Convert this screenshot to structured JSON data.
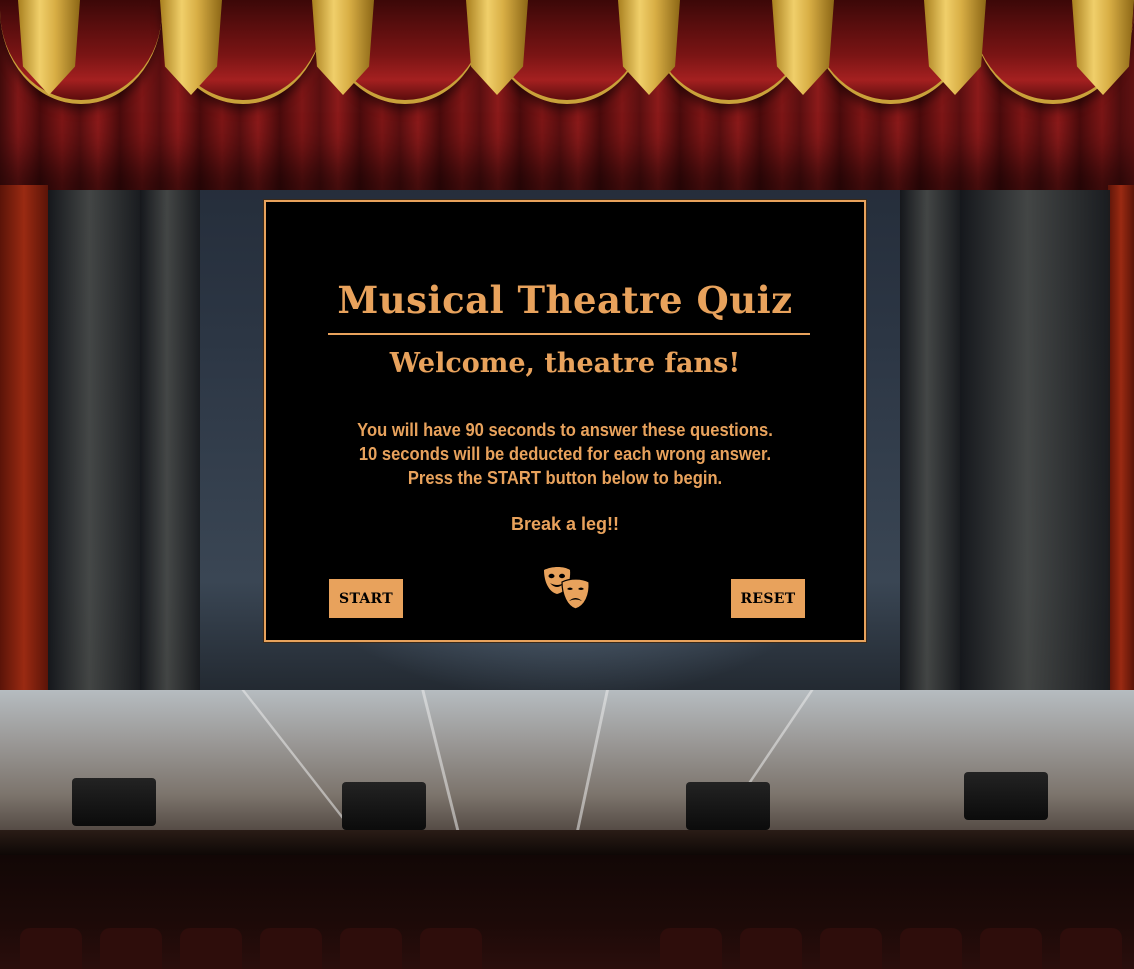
{
  "quiz": {
    "title": "Musical Theatre Quiz",
    "welcome": "Welcome, theatre fans!",
    "instructions": [
      "You will have 90 seconds to answer these questions.",
      "10 seconds will be deducted for each wrong answer.",
      "Press the START button below to begin."
    ],
    "sendoff": "Break a leg!!",
    "start_label": "START",
    "reset_label": "RESET",
    "icon": "theatre-masks-icon"
  },
  "colors": {
    "accent": "#e8a25c",
    "card_background": "#000000",
    "button_text": "#000000"
  }
}
